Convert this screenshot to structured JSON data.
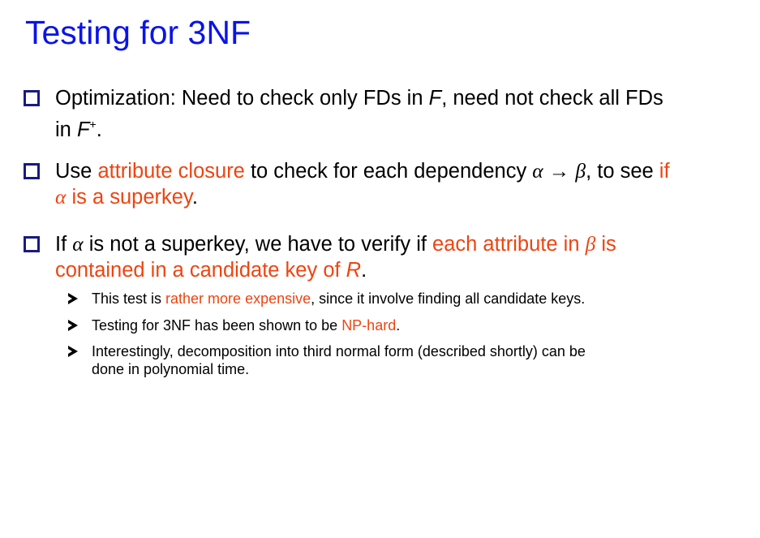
{
  "title": "Testing for 3NF",
  "colors": {
    "title": "#0a14e6",
    "highlight": "#ee4411",
    "checkbox": "#1a1a80",
    "text": "#000000"
  },
  "icons": {
    "bullet": "checkbox-square-icon",
    "sub_bullet": "arrowhead-icon"
  },
  "symbols": {
    "alpha": "α",
    "beta": "β",
    "arrow": "→",
    "plus": "+"
  },
  "bullets": [
    {
      "t1": "Optimization: Need to check only FDs in ",
      "F": "F",
      "t2": ", need not check all FDs",
      "t3": "in ",
      "Fplus": "F",
      "t4": "."
    },
    {
      "t1": "Use ",
      "h1": "attribute closure",
      "t2": " to check for each dependency ",
      "t3": ", to see ",
      "h2": "if",
      "h3": " is a superkey",
      "t4": "."
    },
    {
      "t1": "If ",
      "t2": " is not a superkey, we have to verify if ",
      "h1": "each attribute in ",
      "h2": " is",
      "h3": "contained in a candidate key of ",
      "R": "R",
      "t3": "."
    }
  ],
  "subbullets": [
    {
      "t1": "This test is ",
      "h": "rather more expensive",
      "t2": ", since it involve finding all candidate keys."
    },
    {
      "t1": "Testing for 3NF has been shown to be ",
      "h": "NP-hard",
      "t2": "."
    },
    {
      "t1": "Interestingly, decomposition into third normal form (described shortly) can be",
      "t2": "done in polynomial time."
    }
  ]
}
